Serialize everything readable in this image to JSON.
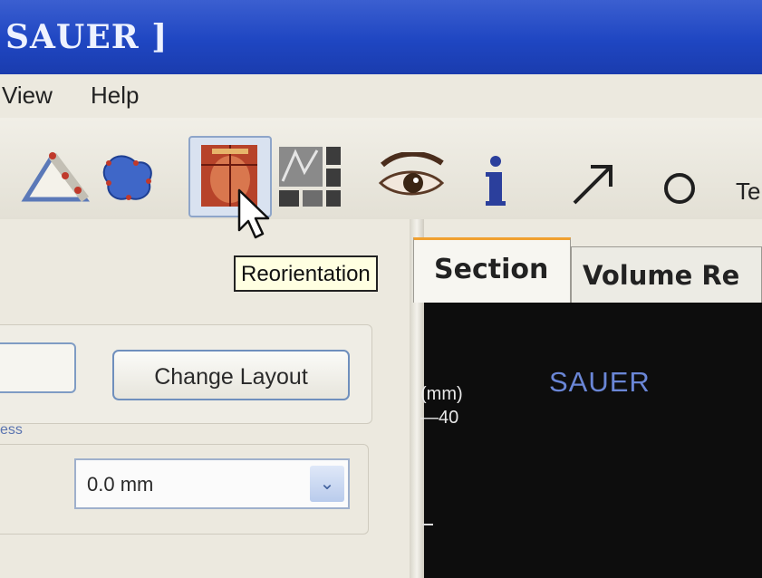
{
  "window": {
    "title": "SAUER ]"
  },
  "menu": {
    "items": [
      "View",
      "Help"
    ]
  },
  "toolbar": {
    "tools": [
      {
        "icon": "angle-measure-icon"
      },
      {
        "icon": "freehand-region-icon"
      },
      {
        "icon": "reorientation-icon",
        "active": true
      },
      {
        "icon": "layout-grid-icon"
      },
      {
        "icon": "eye-icon"
      },
      {
        "icon": "info-icon"
      },
      {
        "icon": "arrow-icon"
      },
      {
        "icon": "circle-icon"
      }
    ],
    "text_tool_label": "Te"
  },
  "tooltip": {
    "text": "Reorientation"
  },
  "tabs": [
    {
      "label": "Section",
      "active": true
    },
    {
      "label": "Volume Re",
      "active": false
    }
  ],
  "left_panel": {
    "change_layout_label": "Change Layout",
    "thickness_label_partial": "ess",
    "thickness_value": "0.0 mm",
    "dropdown_arrow": "⌄"
  },
  "viewport": {
    "patient_name": "SAUER",
    "unit_label": "(mm)",
    "tick_label": "—40"
  },
  "colors": {
    "titlebar": "#1f46c2",
    "tab_accent": "#f0a030",
    "viewport_bg": "#0d0d0d",
    "patient_name": "#6a86d6"
  }
}
